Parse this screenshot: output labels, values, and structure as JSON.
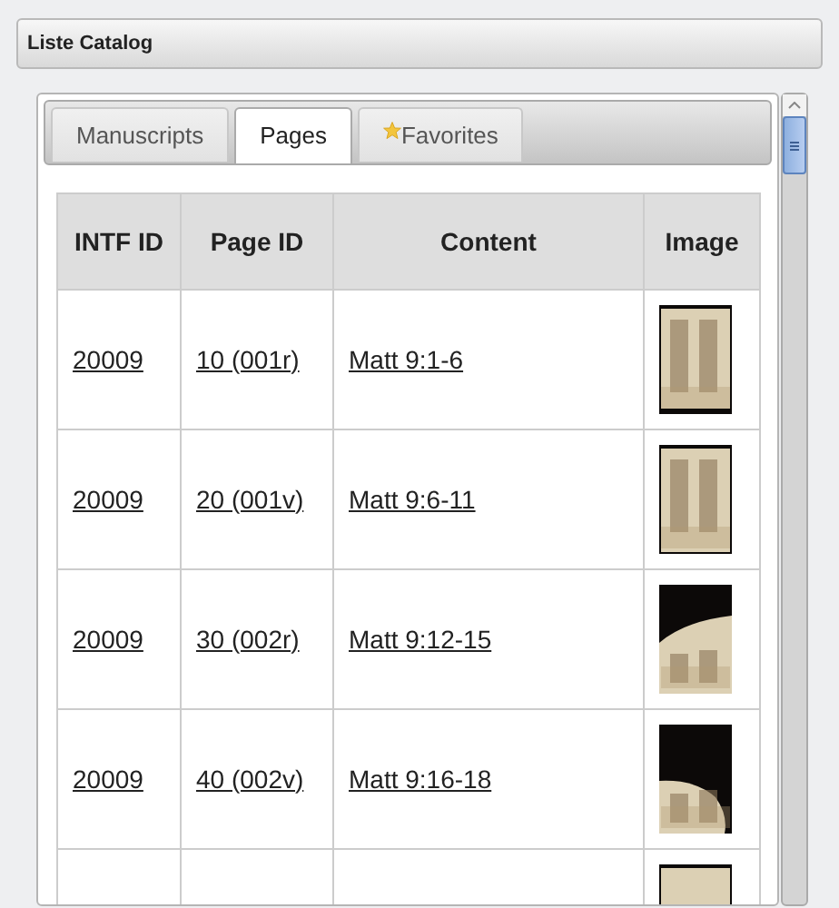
{
  "panel": {
    "title": "Liste Catalog"
  },
  "tabs": [
    {
      "label": "Manuscripts",
      "selected": false,
      "kind": "plain"
    },
    {
      "label": "Pages",
      "selected": true,
      "kind": "plain"
    },
    {
      "label": "Favorites",
      "selected": false,
      "kind": "starred"
    }
  ],
  "table": {
    "columns": [
      "INTF ID",
      "Page ID",
      "Content",
      "Image"
    ],
    "rows": [
      {
        "intf_id": "20009",
        "page_id": "10 (001r)",
        "content": "Matt 9:1-6",
        "image": {
          "kind": "picture"
        }
      },
      {
        "intf_id": "20009",
        "page_id": "20 (001v)",
        "content": "Matt 9:6-11",
        "image": {
          "kind": "picture"
        }
      },
      {
        "intf_id": "20009",
        "page_id": "30 (002r)",
        "content": "Matt 9:12-15",
        "image": {
          "kind": "picture"
        }
      },
      {
        "intf_id": "20009",
        "page_id": "40 (002v)",
        "content": "Matt 9:16-18",
        "image": {
          "kind": "picture"
        }
      },
      {
        "image": {
          "kind": "picture"
        }
      }
    ]
  }
}
